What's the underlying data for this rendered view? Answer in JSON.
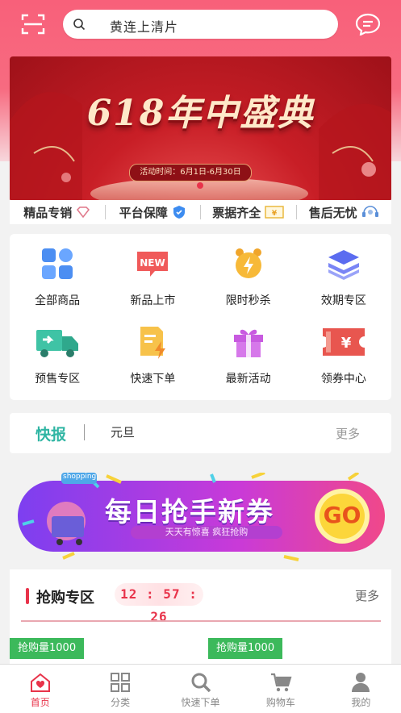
{
  "search": {
    "placeholder": "黄连上清片"
  },
  "banner": {
    "title": "618年中盛典",
    "date": "活动时间：6月1日-6月30日"
  },
  "features": [
    {
      "label": "精品专销",
      "icon": "diamond-icon"
    },
    {
      "label": "平台保障",
      "icon": "shield-icon"
    },
    {
      "label": "票据齐全",
      "icon": "receipt-icon"
    },
    {
      "label": "售后无忧",
      "icon": "headset-icon"
    }
  ],
  "categories": [
    {
      "label": "全部商品",
      "icon": "grid-icon"
    },
    {
      "label": "新品上市",
      "icon": "new-badge-icon"
    },
    {
      "label": "限时秒杀",
      "icon": "alarm-clock-icon"
    },
    {
      "label": "效期专区",
      "icon": "layers-icon"
    },
    {
      "label": "预售专区",
      "icon": "truck-icon"
    },
    {
      "label": "快速下单",
      "icon": "quick-order-icon"
    },
    {
      "label": "最新活动",
      "icon": "gift-icon"
    },
    {
      "label": "领券中心",
      "icon": "coupon-icon"
    }
  ],
  "news": {
    "heading": "快报",
    "text": "元旦",
    "more": "更多"
  },
  "promo": {
    "title": "每日抢手新券",
    "subtitle": "天天有惊喜 疯狂抢购",
    "button": "GO",
    "badge": "shopping"
  },
  "flash": {
    "title": "抢购专区",
    "countdown": "12 : 57 : 26",
    "more": "更多",
    "tags": [
      "抢购量1000",
      "抢购量1000"
    ]
  },
  "tabbar": [
    {
      "label": "首页",
      "icon": "home-icon",
      "active": true
    },
    {
      "label": "分类",
      "icon": "category-icon"
    },
    {
      "label": "快速下单",
      "icon": "search-icon"
    },
    {
      "label": "购物车",
      "icon": "cart-icon"
    },
    {
      "label": "我的",
      "icon": "user-icon"
    }
  ],
  "colors": {
    "brand": "#f8607a",
    "accent": "#e8334a",
    "news": "#2fb5a3",
    "tag": "#3cb95b"
  }
}
